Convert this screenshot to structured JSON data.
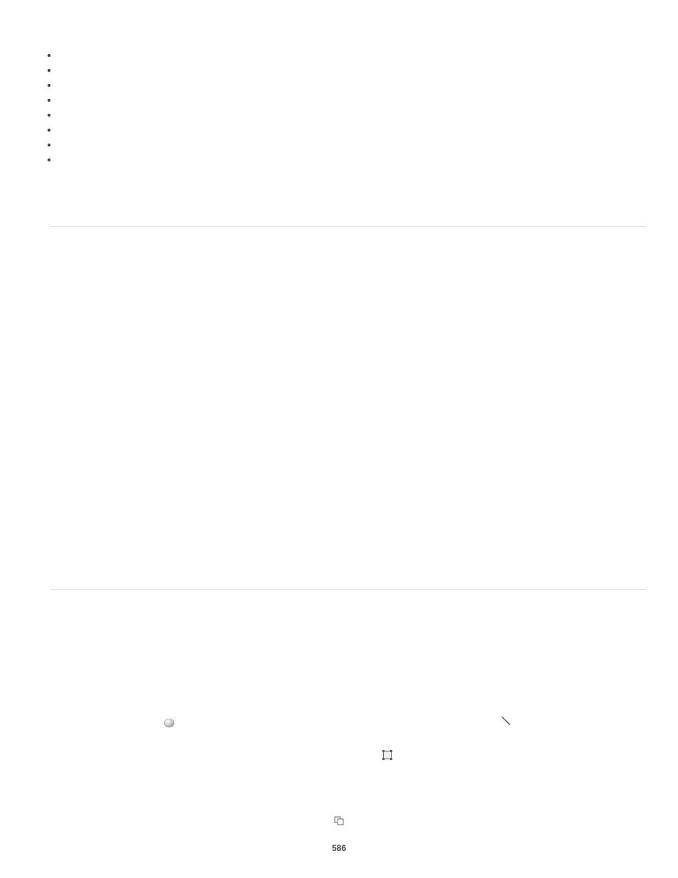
{
  "bullets": [
    "",
    "",
    "",
    "",
    "",
    "",
    "",
    ""
  ],
  "page_number": "586"
}
